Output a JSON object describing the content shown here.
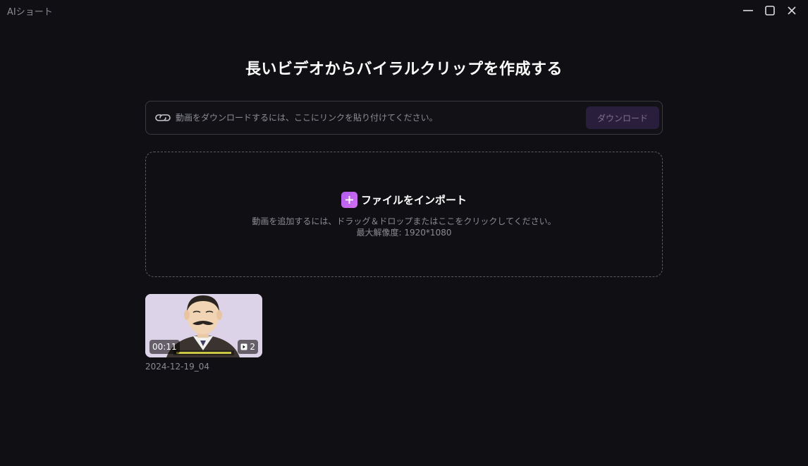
{
  "window": {
    "title": "AIショート"
  },
  "main": {
    "headline": "長いビデオからバイラルクリップを作成する"
  },
  "link_bar": {
    "placeholder": "動画をダウンロードするには、ここにリンクを貼り付けてください。",
    "value": "",
    "download_label": "ダウンロード",
    "icon": "link-icon"
  },
  "dropzone": {
    "import_label": "ファイルをインポート",
    "hint": "動画を追加するには、ドラッグ＆ドロップまたはここをクリックしてください。",
    "max_resolution": "最大解像度: 1920*1080",
    "icon": "plus-icon"
  },
  "videos": [
    {
      "title": "2024-12-19_04",
      "duration": "00:11",
      "clip_count": "2"
    }
  ],
  "colors": {
    "background": "#101014",
    "accent": "#c069f0",
    "download_button_bg": "#2a1e3d"
  }
}
